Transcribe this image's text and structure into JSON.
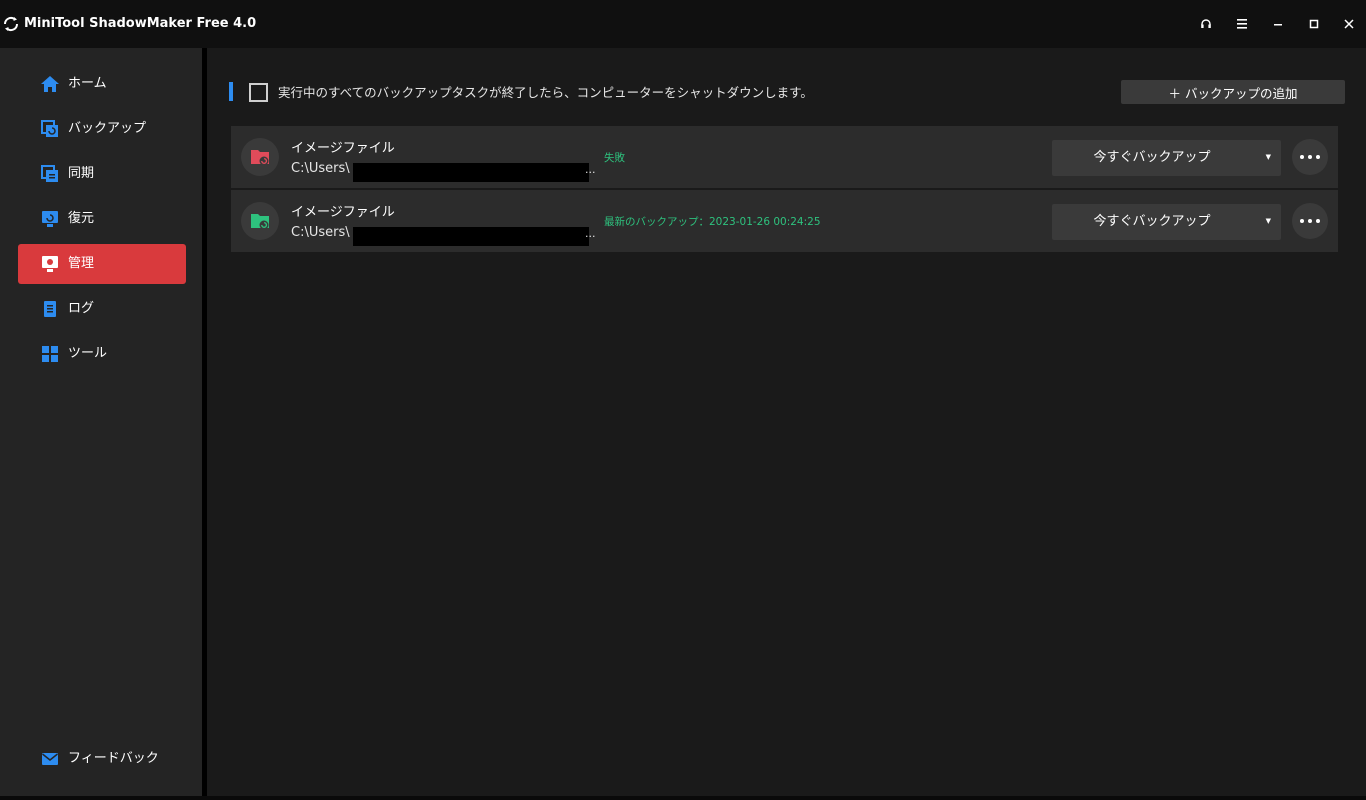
{
  "window": {
    "title": "MiniTool ShadowMaker Free 4.0",
    "controls": {
      "support": "headset-icon",
      "menu": "menu-icon",
      "minimize": "minimize-icon",
      "maximize": "maximize-icon",
      "close": "close-icon"
    }
  },
  "sidebar": {
    "items": [
      {
        "label": "ホーム",
        "icon": "home-icon"
      },
      {
        "label": "バックアップ",
        "icon": "backup-icon"
      },
      {
        "label": "同期",
        "icon": "sync-icon"
      },
      {
        "label": "復元",
        "icon": "restore-icon"
      },
      {
        "label": "管理",
        "icon": "manage-icon",
        "active": true
      },
      {
        "label": "ログ",
        "icon": "log-icon"
      },
      {
        "label": "ツール",
        "icon": "tools-icon"
      }
    ],
    "feedback": {
      "label": "フィードバック",
      "icon": "mail-icon"
    }
  },
  "main": {
    "shutdown_option": {
      "label": "実行中のすべてのバックアップタスクが終了したら、コンピューターをシャットダウンします。",
      "checked": false
    },
    "add_backup_button": "＋ バックアップの追加",
    "tasks": [
      {
        "name": "イメージファイル",
        "path": "C:\\Users\\",
        "path_suffix": "...",
        "status": "失敗",
        "status_color": "#2ec27e",
        "icon_color": "#e04b5a",
        "action_label": "今すぐバックアップ"
      },
      {
        "name": "イメージファイル",
        "path": "C:\\Users\\",
        "path_suffix": "...",
        "status": "最新のバックアップ：2023-01-26 00:24:25",
        "status_color": "#2ec27e",
        "icon_color": "#2ec27e",
        "action_label": "今すぐバックアップ"
      }
    ]
  },
  "colors": {
    "accent": "#d93a3d",
    "highlight": "#2d8cf0",
    "success": "#2ec27e"
  }
}
